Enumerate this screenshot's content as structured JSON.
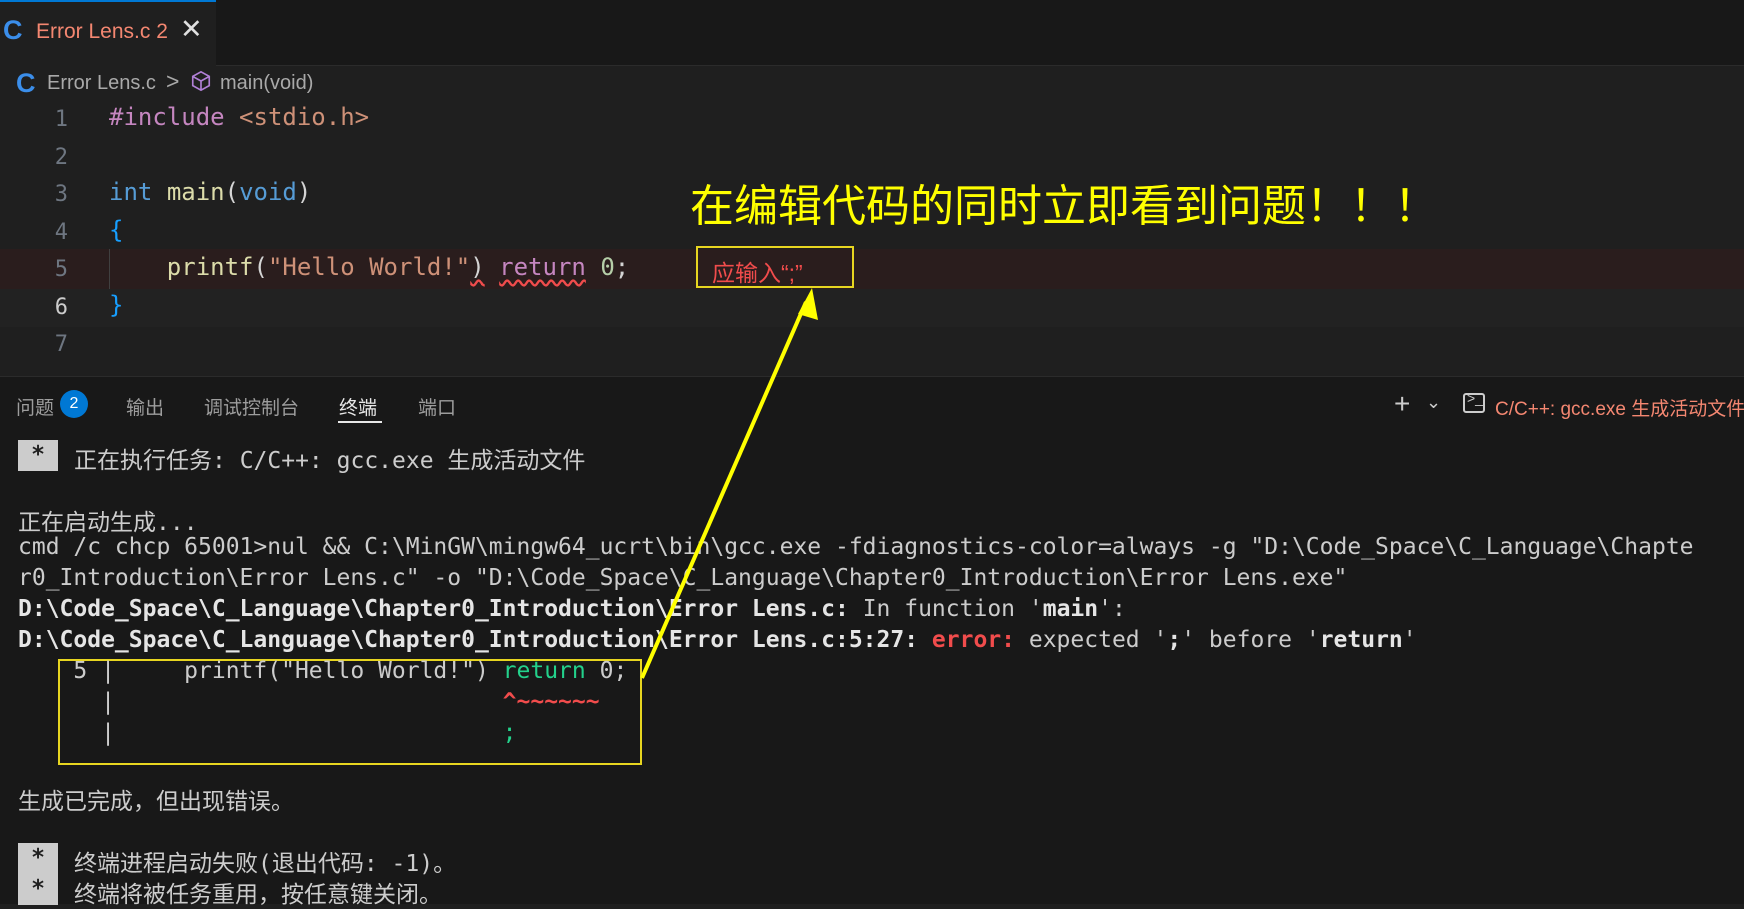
{
  "tab": {
    "icon": "c-language-icon",
    "title": "Error Lens.c",
    "problem_count": "2",
    "close_glyph": "✕"
  },
  "breadcrumb": {
    "file": "Error Lens.c",
    "separator": ">",
    "symbol": "main(void)"
  },
  "editor": {
    "line_numbers": [
      "1",
      "2",
      "3",
      "4",
      "5",
      "6",
      "7"
    ],
    "line1": {
      "directive": "#include",
      "header": " <stdio.h>"
    },
    "line3": {
      "type": "int",
      "space": " ",
      "name": "main",
      "open": "(",
      "param": "void",
      "close": ")"
    },
    "line4": {
      "brace": "{"
    },
    "line5": {
      "indent": "    ",
      "fn": "printf",
      "open": "(",
      "str": "\"Hello World!\"",
      "close": ")",
      "space": " ",
      "kw": "return",
      "space2": " ",
      "num": "0",
      "semi": ";"
    },
    "line6": {
      "brace": "}"
    },
    "inline_error": "应输入“;”"
  },
  "annotation": "在编辑代码的同时立即看到问题！！！",
  "panel": {
    "tabs": [
      "问题",
      "输出",
      "调试控制台",
      "终端",
      "端口"
    ],
    "problems_badge": "2",
    "active_tab": "终端",
    "terminal_name": "C/C++: gcc.exe 生成活动文件",
    "plus_glyph": "+",
    "chevron_glyph": "⌄",
    "term_glyph": ">_"
  },
  "terminal": {
    "star": "*",
    "task_line": "正在执行任务: C/C++: gcc.exe 生成活动文件",
    "starting": "正在启动生成...",
    "cmd1": "cmd /c chcp 65001>nul && C:\\MinGW\\mingw64_ucrt\\bin\\gcc.exe -fdiagnostics-color=always -g \"D:\\Code_Space\\C_Language\\Chapte",
    "cmd2": "r0_Introduction\\Error Lens.c\" -o \"D:\\Code_Space\\C_Language\\Chapter0_Introduction\\Error Lens.exe\"",
    "infunc_path": "D:\\Code_Space\\C_Language\\Chapter0_Introduction\\Error Lens.c:",
    "infunc_text": " In function '",
    "infunc_name": "main",
    "infunc_end": "':",
    "err_path": "D:\\Code_Space\\C_Language\\Chapter0_Introduction\\Error Lens.c:5:27:",
    "err_label": " error:",
    "err_msg1": " expected '",
    "err_semi": ";",
    "err_msg2": "' before '",
    "err_return": "return",
    "err_msg3": "'",
    "snippet_line_no": "    5 |     printf(\"Hello World!\") ",
    "snippet_return": "return",
    "snippet_end": " 0;",
    "snippet2_prefix": "      |                            ",
    "snippet2_caret": "^~~~~~~",
    "snippet3_prefix": "      |                            ",
    "snippet3_fix": ";",
    "done": "生成已完成，但出现错误。",
    "fail1": "终端进程启动失败(退出代码: -1)。",
    "fail2": "终端将被任务重用，按任意键关闭。"
  }
}
